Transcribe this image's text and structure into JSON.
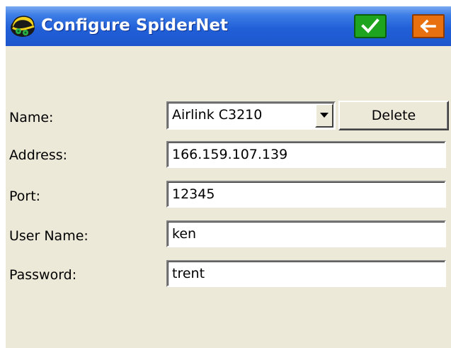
{
  "window": {
    "title": "Configure SpiderNet",
    "app_icon": "spidernet-helmet-icon",
    "ok_icon": "checkmark-icon",
    "back_icon": "back-arrow-icon",
    "colors": {
      "titlebar": "#2160d8",
      "ok_button": "#1ea41e",
      "back_button": "#e8700f",
      "background": "#ece9d8"
    }
  },
  "form": {
    "name": {
      "label": "Name:",
      "selected": "Airlink C3210",
      "dropdown_icon": "chevron-down-icon"
    },
    "delete_label": "Delete",
    "address": {
      "label": "Address:",
      "value": "166.159.107.139"
    },
    "port": {
      "label": "Port:",
      "value": "12345"
    },
    "username": {
      "label": "User Name:",
      "value": "ken"
    },
    "password": {
      "label": "Password:",
      "value": "trent"
    }
  }
}
